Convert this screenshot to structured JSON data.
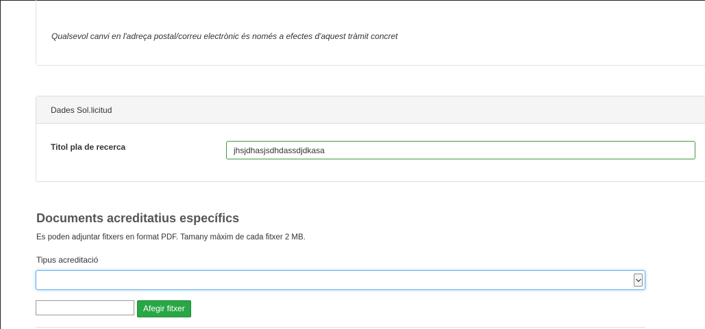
{
  "notice": {
    "text": "Qualsevol canvi en l'adreça postal/correu electrònic és només a efectes d'aquest tràmit concret"
  },
  "dades": {
    "heading": "Dades Sol.licitud",
    "field_label": "Titol pla de recerca",
    "field_value": "jhsjdhasjsdhdassdjdkasa"
  },
  "documents": {
    "title": "Documents acreditatius específics",
    "description": "Es poden adjuntar fitxers en format PDF. Tamany màxim de cada fitxer 2 MB.",
    "select_label": "Tipus acreditació",
    "select_value": "",
    "select_icon": "chevron-down-icon",
    "file_value": "",
    "add_button_label": "Afegir fitxer",
    "add_button_color": "#28a745"
  }
}
